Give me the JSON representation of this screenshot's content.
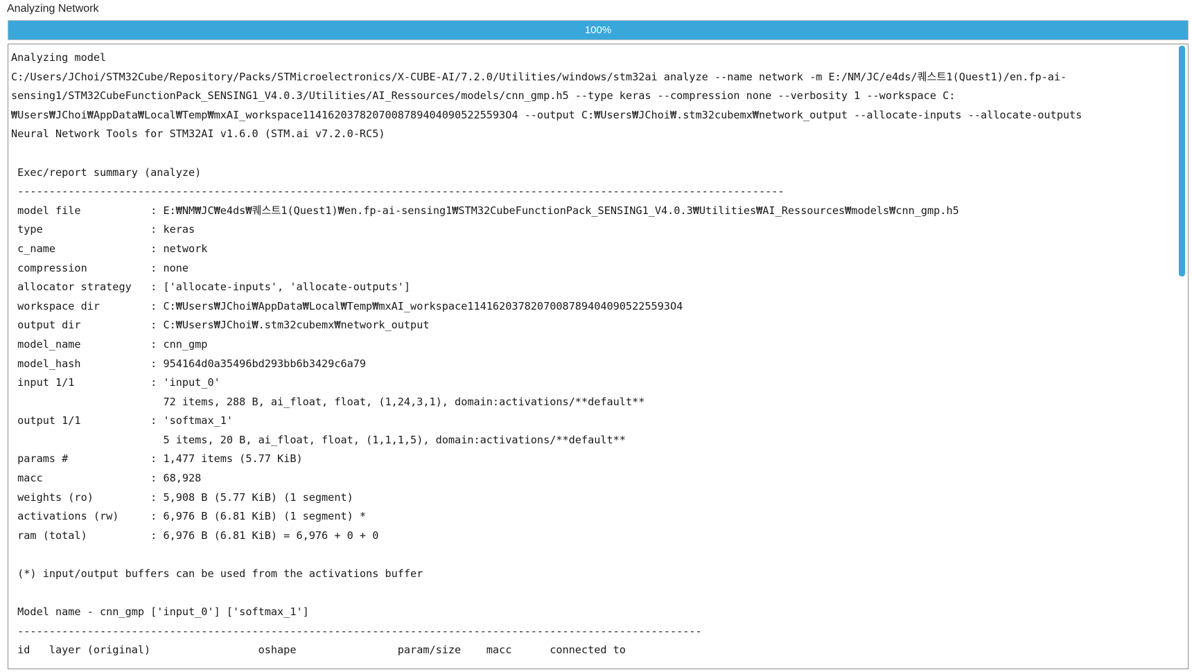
{
  "window": {
    "title": "Analyzing Network"
  },
  "progress": {
    "value": 100,
    "label": "100%",
    "color": "#3aa7db"
  },
  "console": {
    "lines": [
      "Analyzing model",
      "C:/Users/JChoi/STM32Cube/Repository/Packs/STMicroelectronics/X-CUBE-AI/7.2.0/Utilities/windows/stm32ai analyze --name network -m E:/NM/JC/e4ds/퀘스트1(Quest1)/en.fp-ai-",
      "sensing1/STM32CubeFunctionPack_SENSING1_V4.0.3/Utilities/AI_Ressources/models/cnn_gmp.h5 --type keras --compression none --verbosity 1 --workspace C:",
      "₩Users₩JChoi₩AppData₩Local₩Temp₩mxAI_workspace11416203782070087894040905225593O4 --output C:₩Users₩JChoi₩.stm32cubemx₩network_output --allocate-inputs --allocate-outputs",
      "Neural Network Tools for STM32AI v1.6.0 (STM.ai v7.2.0-RC5)",
      "",
      " Exec/report summary (analyze)",
      " -------------------------------------------------------------------------------------------------------------------------",
      " model file           : E:₩NM₩JC₩e4ds₩퀘스트1(Quest1)₩en.fp-ai-sensing1₩STM32CubeFunctionPack_SENSING1_V4.0.3₩Utilities₩AI_Ressources₩models₩cnn_gmp.h5",
      " type                 : keras",
      " c_name               : network",
      " compression          : none",
      " allocator strategy   : ['allocate-inputs', 'allocate-outputs']",
      " workspace dir        : C:₩Users₩JChoi₩AppData₩Local₩Temp₩mxAI_workspace11416203782070087894040905225593O4",
      " output dir           : C:₩Users₩JChoi₩.stm32cubemx₩network_output",
      " model_name           : cnn_gmp",
      " model_hash           : 954164d0a35496bd293bb6b3429c6a79",
      " input 1/1            : 'input_0'",
      "                        72 items, 288 B, ai_float, float, (1,24,3,1), domain:activations/**default**",
      " output 1/1           : 'softmax_1'",
      "                        5 items, 20 B, ai_float, float, (1,1,1,5), domain:activations/**default**",
      " params #             : 1,477 items (5.77 KiB)",
      " macc                 : 68,928",
      " weights (ro)         : 5,908 B (5.77 KiB) (1 segment)",
      " activations (rw)     : 6,976 B (6.81 KiB) (1 segment) *",
      " ram (total)          : 6,976 B (6.81 KiB) = 6,976 + 0 + 0",
      "",
      " (*) input/output buffers can be used from the activations buffer",
      "",
      " Model name - cnn_gmp ['input_0'] ['softmax_1']",
      " ------------------------------------------------------------------------------------------------------------",
      " id   layer (original)                 oshape                param/size    macc      connected to",
      " ------------------------------------------------------------------------------------------------------------"
    ]
  }
}
